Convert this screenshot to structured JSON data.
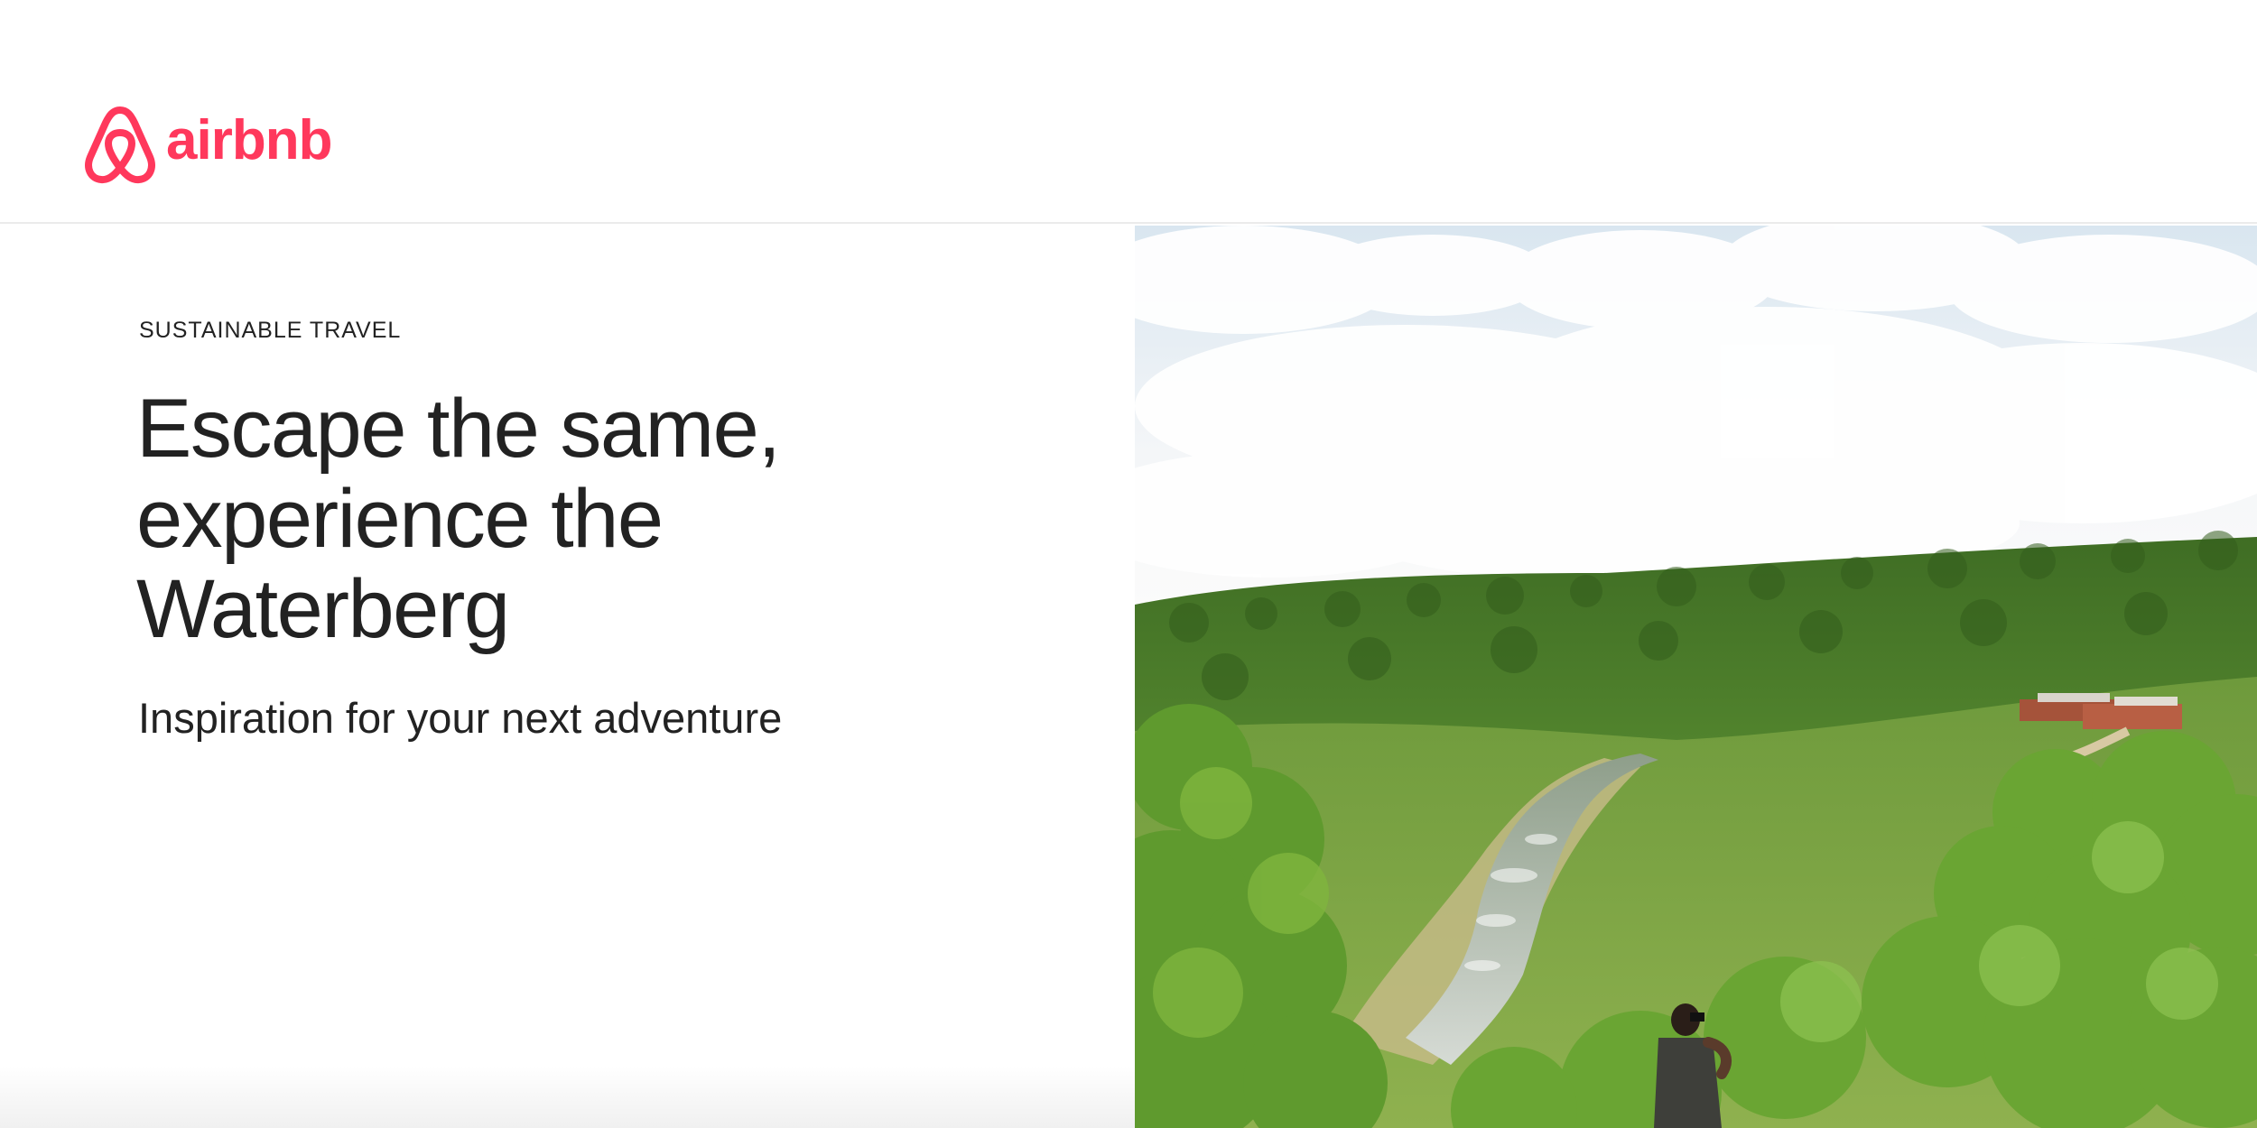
{
  "brand": {
    "name": "airbnb",
    "color": "#FF385C",
    "icon": "airbnb-belo-icon"
  },
  "hero": {
    "eyebrow": "SUSTAINABLE TRAVEL",
    "headline_lines": [
      "Escape the same,",
      "experience the",
      "Waterberg"
    ],
    "subtitle": "Inspiration for your next adventure",
    "photo": {
      "description_icon": "landscape-photo",
      "sky_color": "#eef3f7",
      "foliage_color": "#4f8a2c",
      "river_color": "#c9cfc8"
    }
  }
}
